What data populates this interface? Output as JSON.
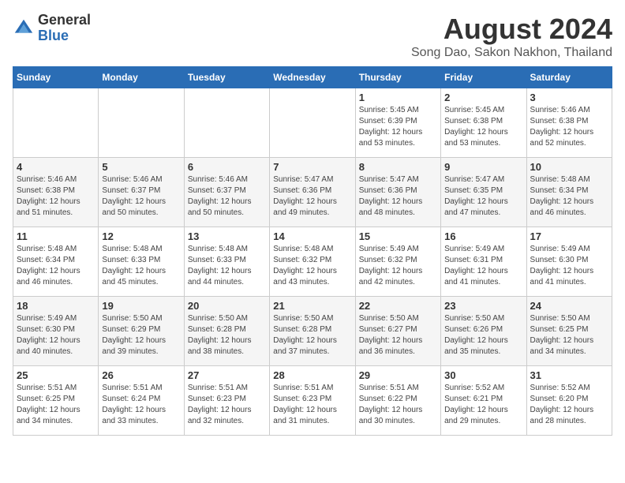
{
  "logo": {
    "general": "General",
    "blue": "Blue"
  },
  "header": {
    "month_year": "August 2024",
    "location": "Song Dao, Sakon Nakhon, Thailand"
  },
  "weekdays": [
    "Sunday",
    "Monday",
    "Tuesday",
    "Wednesday",
    "Thursday",
    "Friday",
    "Saturday"
  ],
  "weeks": [
    [
      {
        "day": "",
        "content": ""
      },
      {
        "day": "",
        "content": ""
      },
      {
        "day": "",
        "content": ""
      },
      {
        "day": "",
        "content": ""
      },
      {
        "day": "1",
        "content": "Sunrise: 5:45 AM\nSunset: 6:39 PM\nDaylight: 12 hours\nand 53 minutes."
      },
      {
        "day": "2",
        "content": "Sunrise: 5:45 AM\nSunset: 6:38 PM\nDaylight: 12 hours\nand 53 minutes."
      },
      {
        "day": "3",
        "content": "Sunrise: 5:46 AM\nSunset: 6:38 PM\nDaylight: 12 hours\nand 52 minutes."
      }
    ],
    [
      {
        "day": "4",
        "content": "Sunrise: 5:46 AM\nSunset: 6:38 PM\nDaylight: 12 hours\nand 51 minutes."
      },
      {
        "day": "5",
        "content": "Sunrise: 5:46 AM\nSunset: 6:37 PM\nDaylight: 12 hours\nand 50 minutes."
      },
      {
        "day": "6",
        "content": "Sunrise: 5:46 AM\nSunset: 6:37 PM\nDaylight: 12 hours\nand 50 minutes."
      },
      {
        "day": "7",
        "content": "Sunrise: 5:47 AM\nSunset: 6:36 PM\nDaylight: 12 hours\nand 49 minutes."
      },
      {
        "day": "8",
        "content": "Sunrise: 5:47 AM\nSunset: 6:36 PM\nDaylight: 12 hours\nand 48 minutes."
      },
      {
        "day": "9",
        "content": "Sunrise: 5:47 AM\nSunset: 6:35 PM\nDaylight: 12 hours\nand 47 minutes."
      },
      {
        "day": "10",
        "content": "Sunrise: 5:48 AM\nSunset: 6:34 PM\nDaylight: 12 hours\nand 46 minutes."
      }
    ],
    [
      {
        "day": "11",
        "content": "Sunrise: 5:48 AM\nSunset: 6:34 PM\nDaylight: 12 hours\nand 46 minutes."
      },
      {
        "day": "12",
        "content": "Sunrise: 5:48 AM\nSunset: 6:33 PM\nDaylight: 12 hours\nand 45 minutes."
      },
      {
        "day": "13",
        "content": "Sunrise: 5:48 AM\nSunset: 6:33 PM\nDaylight: 12 hours\nand 44 minutes."
      },
      {
        "day": "14",
        "content": "Sunrise: 5:48 AM\nSunset: 6:32 PM\nDaylight: 12 hours\nand 43 minutes."
      },
      {
        "day": "15",
        "content": "Sunrise: 5:49 AM\nSunset: 6:32 PM\nDaylight: 12 hours\nand 42 minutes."
      },
      {
        "day": "16",
        "content": "Sunrise: 5:49 AM\nSunset: 6:31 PM\nDaylight: 12 hours\nand 41 minutes."
      },
      {
        "day": "17",
        "content": "Sunrise: 5:49 AM\nSunset: 6:30 PM\nDaylight: 12 hours\nand 41 minutes."
      }
    ],
    [
      {
        "day": "18",
        "content": "Sunrise: 5:49 AM\nSunset: 6:30 PM\nDaylight: 12 hours\nand 40 minutes."
      },
      {
        "day": "19",
        "content": "Sunrise: 5:50 AM\nSunset: 6:29 PM\nDaylight: 12 hours\nand 39 minutes."
      },
      {
        "day": "20",
        "content": "Sunrise: 5:50 AM\nSunset: 6:28 PM\nDaylight: 12 hours\nand 38 minutes."
      },
      {
        "day": "21",
        "content": "Sunrise: 5:50 AM\nSunset: 6:28 PM\nDaylight: 12 hours\nand 37 minutes."
      },
      {
        "day": "22",
        "content": "Sunrise: 5:50 AM\nSunset: 6:27 PM\nDaylight: 12 hours\nand 36 minutes."
      },
      {
        "day": "23",
        "content": "Sunrise: 5:50 AM\nSunset: 6:26 PM\nDaylight: 12 hours\nand 35 minutes."
      },
      {
        "day": "24",
        "content": "Sunrise: 5:50 AM\nSunset: 6:25 PM\nDaylight: 12 hours\nand 34 minutes."
      }
    ],
    [
      {
        "day": "25",
        "content": "Sunrise: 5:51 AM\nSunset: 6:25 PM\nDaylight: 12 hours\nand 34 minutes."
      },
      {
        "day": "26",
        "content": "Sunrise: 5:51 AM\nSunset: 6:24 PM\nDaylight: 12 hours\nand 33 minutes."
      },
      {
        "day": "27",
        "content": "Sunrise: 5:51 AM\nSunset: 6:23 PM\nDaylight: 12 hours\nand 32 minutes."
      },
      {
        "day": "28",
        "content": "Sunrise: 5:51 AM\nSunset: 6:23 PM\nDaylight: 12 hours\nand 31 minutes."
      },
      {
        "day": "29",
        "content": "Sunrise: 5:51 AM\nSunset: 6:22 PM\nDaylight: 12 hours\nand 30 minutes."
      },
      {
        "day": "30",
        "content": "Sunrise: 5:52 AM\nSunset: 6:21 PM\nDaylight: 12 hours\nand 29 minutes."
      },
      {
        "day": "31",
        "content": "Sunrise: 5:52 AM\nSunset: 6:20 PM\nDaylight: 12 hours\nand 28 minutes."
      }
    ]
  ]
}
